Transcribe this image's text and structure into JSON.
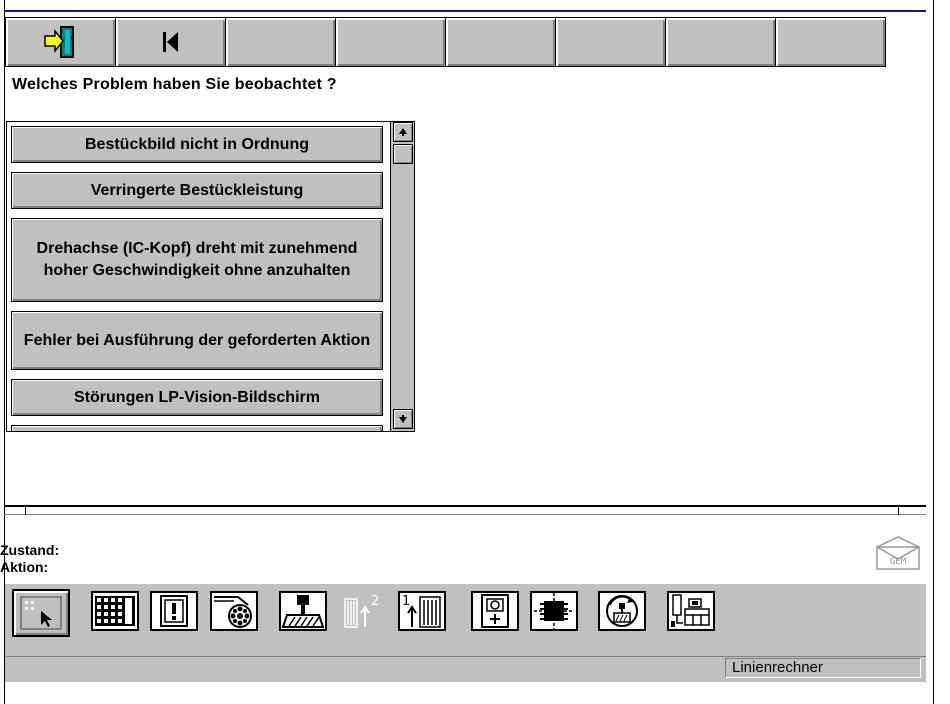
{
  "toolbar": {
    "buttons": [
      {
        "icon": "exit-door-icon"
      },
      {
        "icon": "first-page-icon"
      },
      {},
      {},
      {},
      {},
      {},
      {}
    ]
  },
  "question": "Welches Problem haben Sie beobachtet ?",
  "problems": [
    "Bestückbild nicht in Ordnung",
    "Verringerte Bestückleistung",
    "Drehachse (IC-Kopf) dreht mit zunehmend hoher Geschwindigkeit ohne anzuhalten",
    "Fehler bei Ausführung der geforderten Aktion",
    "Störungen LP-Vision-Bildschirm"
  ],
  "status": {
    "state_label": "Zustand:",
    "action_label": "Aktion:"
  },
  "gem": {
    "label": "GEM",
    "icon": "gem-envelope-icon"
  },
  "bottom_toolbar": [
    {
      "icon": "select-cursor-icon"
    },
    {
      "icon": "feeder-table-icon"
    },
    {
      "icon": "alert-icon"
    },
    {
      "icon": "tape-reel-icon"
    },
    {
      "icon": "placement-head-icon"
    },
    {
      "icon": "stack-2-icon",
      "disabled": true
    },
    {
      "icon": "stack-1-icon"
    },
    {
      "icon": "camera-icon"
    },
    {
      "icon": "component-chip-icon"
    },
    {
      "icon": "rotate-nozzle-icon"
    },
    {
      "icon": "machine-station-icon"
    }
  ],
  "statusbar": {
    "host": "Linienrechner"
  },
  "colors": {
    "face": "#c0c0c0",
    "topline": "#1a1a6e"
  }
}
